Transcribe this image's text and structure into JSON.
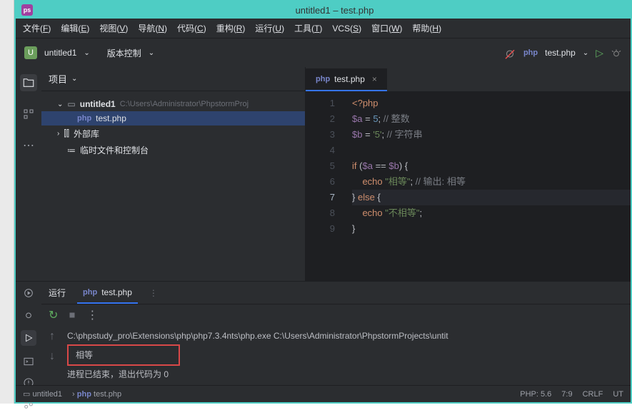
{
  "window": {
    "title": "untitled1 – test.php"
  },
  "menu": [
    "文件(F)",
    "编辑(E)",
    "视图(V)",
    "导航(N)",
    "代码(C)",
    "重构(R)",
    "运行(U)",
    "工具(T)",
    "VCS(S)",
    "窗口(W)",
    "帮助(H)"
  ],
  "nav": {
    "project_name": "untitled1",
    "vcs_label": "版本控制",
    "run_config": "test.php"
  },
  "project_panel": {
    "header": "项目",
    "root": {
      "name": "untitled1",
      "path": "C:\\Users\\Administrator\\PhpstormProj"
    },
    "file": "test.php",
    "externals": "外部库",
    "scratches": "临时文件和控制台"
  },
  "editor": {
    "tab": "test.php",
    "lines": [
      {
        "n": 1,
        "html": "<span class='tag'>&lt;?php</span>"
      },
      {
        "n": 2,
        "html": "<span class='var'>$a</span> <span class='punct'>=</span> <span class='num'>5</span><span class='punct'>;</span> <span class='cmt'>// 整数</span>"
      },
      {
        "n": 3,
        "html": "<span class='var'>$b</span> <span class='punct'>=</span> <span class='str'>'5'</span><span class='punct'>;</span> <span class='cmt'>// 字符串</span>"
      },
      {
        "n": 4,
        "html": ""
      },
      {
        "n": 5,
        "html": "<span class='kw'>if</span> <span class='punct'>(</span><span class='var'>$a</span> <span class='punct'>==</span> <span class='var'>$b</span><span class='punct'>) {</span>"
      },
      {
        "n": 6,
        "html": "&nbsp;&nbsp;&nbsp;&nbsp;<span class='kw'>echo</span> <span class='str'>\"相等\"</span><span class='punct'>;</span> <span class='cmt'>// 输出: 相等</span>"
      },
      {
        "n": 7,
        "html": "<span class='punct'>}</span> <span class='kw'>else</span> <span class='punct'>{</span>",
        "current": true
      },
      {
        "n": 8,
        "html": "&nbsp;&nbsp;&nbsp;&nbsp;<span class='kw'>echo</span> <span class='str'>\"不相等\"</span><span class='punct'>;</span>"
      },
      {
        "n": 9,
        "html": "<span class='punct'>}</span>"
      }
    ]
  },
  "run_panel": {
    "run_label": "运行",
    "tab": "test.php",
    "command": "C:\\phpstudy_pro\\Extensions\\php\\php7.3.4nts\\php.exe C:\\Users\\Administrator\\PhpstormProjects\\untit",
    "output": "相等",
    "exit": "进程已结束，退出代码为 0"
  },
  "status": {
    "breadcrumb1": "untitled1",
    "breadcrumb2": "test.php",
    "php": "PHP: 5.6",
    "pos": "7:9",
    "crlf": "CRLF",
    "enc": "UT"
  }
}
